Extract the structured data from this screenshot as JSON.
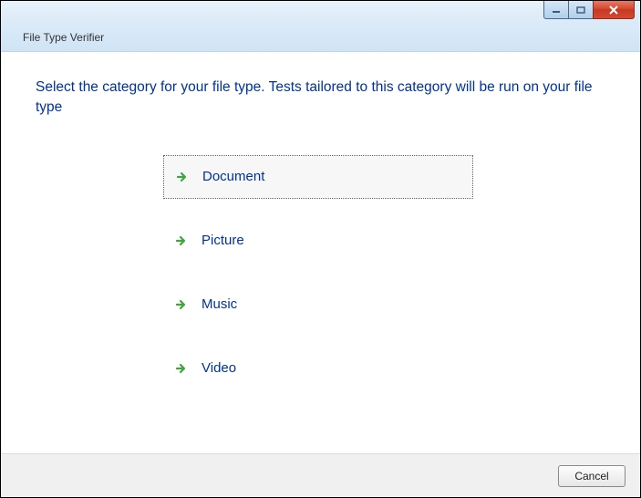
{
  "window": {
    "title": "File Type Verifier"
  },
  "heading": "Select the category for your file type.  Tests tailored to this category will be run on your file type",
  "options": [
    {
      "label": "Document",
      "focused": true
    },
    {
      "label": "Picture",
      "focused": false
    },
    {
      "label": "Music",
      "focused": false
    },
    {
      "label": "Video",
      "focused": false
    }
  ],
  "footer": {
    "cancel": "Cancel"
  }
}
